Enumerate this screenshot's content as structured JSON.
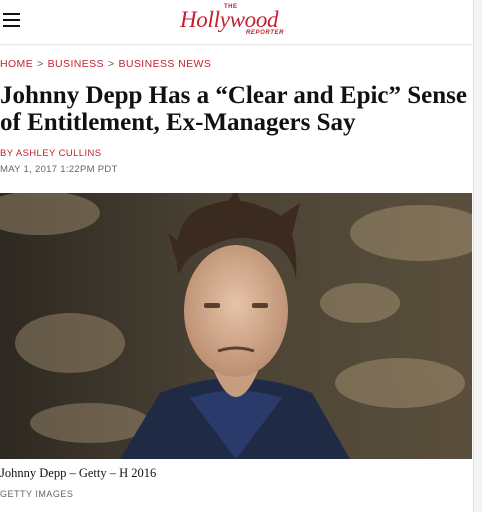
{
  "header": {
    "menu_icon": "hamburger-menu-icon",
    "logo": {
      "the": "THE",
      "main": "Hollywood",
      "sub": "REPORTER"
    }
  },
  "breadcrumb": [
    "HOME",
    "BUSINESS",
    "BUSINESS NEWS"
  ],
  "article": {
    "title": "Johnny Depp Has a “Clear and Epic” Sense of Entitlement, Ex-Managers Say",
    "byline_prefix": "BY",
    "author": "ASHLEY CULLINS",
    "date": "MAY 1, 2017 1:22PM PDT"
  },
  "photo": {
    "caption": "Johnny Depp – Getty – H 2016",
    "credit": "GETTY IMAGES"
  },
  "colors": {
    "accent": "#c41f2f"
  }
}
